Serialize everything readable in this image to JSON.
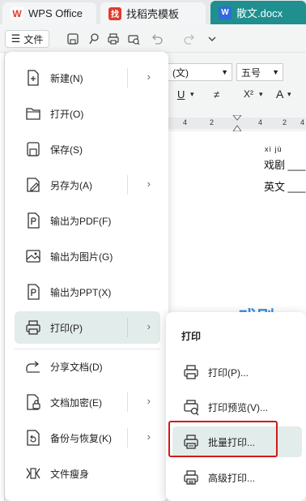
{
  "tabs": [
    {
      "label": "WPS Office",
      "icon": "wps-logo-icon"
    },
    {
      "label": "找稻壳模板",
      "icon": "template-icon"
    },
    {
      "label": "散文.docx",
      "icon": "word-doc-icon",
      "active": true
    }
  ],
  "toolbar": {
    "file_label": "文件",
    "icons": [
      "save-icon",
      "format-painter-icon",
      "print-icon",
      "print-preview-icon",
      "undo-icon",
      "redo-icon",
      "more-icon"
    ]
  },
  "ribbon": {
    "font_name": "(文)",
    "font_size": "五号"
  },
  "ruler": {
    "ticks": [
      "4",
      "2",
      "4",
      "2",
      "4"
    ]
  },
  "document": {
    "pinyin": "xì jù",
    "line1": "戏剧 ___",
    "line2": "英文 ___",
    "heading": "戏剧"
  },
  "file_menu": {
    "items": [
      {
        "label": "新建(N)",
        "icon": "new-icon",
        "has_submenu": true
      },
      {
        "label": "打开(O)",
        "icon": "folder-icon",
        "has_submenu": false
      },
      {
        "label": "保存(S)",
        "icon": "save-icon",
        "has_submenu": false
      },
      {
        "label": "另存为(A)",
        "icon": "save-as-icon",
        "has_submenu": true
      },
      {
        "label": "输出为PDF(F)",
        "icon": "pdf-icon",
        "has_submenu": false
      },
      {
        "label": "输出为图片(G)",
        "icon": "image-icon",
        "has_submenu": false
      },
      {
        "label": "输出为PPT(X)",
        "icon": "ppt-icon",
        "has_submenu": false
      },
      {
        "label": "打印(P)",
        "icon": "print-icon",
        "has_submenu": true,
        "active": true
      },
      {
        "label": "分享文档(D)",
        "icon": "share-icon",
        "has_submenu": false
      },
      {
        "label": "文档加密(E)",
        "icon": "encrypt-icon",
        "has_submenu": true
      },
      {
        "label": "备份与恢复(K)",
        "icon": "backup-icon",
        "has_submenu": true
      },
      {
        "label": "文件瘦身",
        "icon": "slim-icon",
        "has_submenu": false
      }
    ]
  },
  "print_submenu": {
    "title": "打印",
    "items": [
      {
        "label": "打印(P)...",
        "icon": "print-icon"
      },
      {
        "label": "打印预览(V)...",
        "icon": "print-preview-icon"
      },
      {
        "label": "批量打印...",
        "icon": "batch-print-icon",
        "highlighted": true
      },
      {
        "label": "高级打印...",
        "icon": "advanced-print-icon"
      }
    ]
  },
  "colors": {
    "accent": "#1f8f8f",
    "highlight": "#e2ecea",
    "annotation_box": "#d31919"
  }
}
